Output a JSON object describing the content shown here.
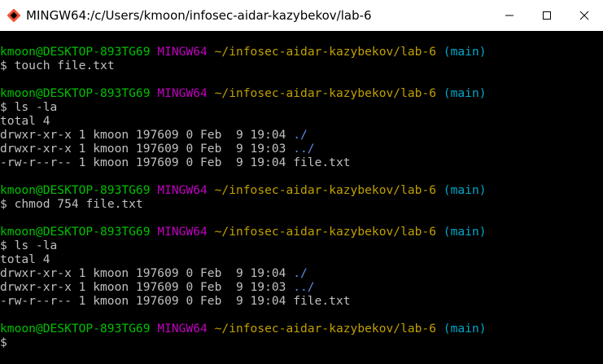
{
  "window": {
    "title": "MINGW64:/c/Users/kmoon/infosec-aidar-kazybekov/lab-6"
  },
  "prompt": {
    "user": "kmoon@DESKTOP-893TG69",
    "env": "MINGW64",
    "path": "~/infosec-aidar-kazybekov/lab-6",
    "branch": "(main)",
    "symbol": "$"
  },
  "blocks": [
    {
      "command": "touch file.txt",
      "output": []
    },
    {
      "command": "ls -la",
      "output": [
        {
          "text": "total 4"
        },
        {
          "text": "drwxr-xr-x 1 kmoon 197609 0 Feb  9 19:04 ",
          "name": "./",
          "is_dir": true
        },
        {
          "text": "drwxr-xr-x 1 kmoon 197609 0 Feb  9 19:03 ",
          "name": "../",
          "is_dir": true
        },
        {
          "text": "-rw-r--r-- 1 kmoon 197609 0 Feb  9 19:04 ",
          "name": "file.txt",
          "is_dir": false
        }
      ]
    },
    {
      "command": "chmod 754 file.txt",
      "output": []
    },
    {
      "command": "ls -la",
      "output": [
        {
          "text": "total 4"
        },
        {
          "text": "drwxr-xr-x 1 kmoon 197609 0 Feb  9 19:04 ",
          "name": "./",
          "is_dir": true
        },
        {
          "text": "drwxr-xr-x 1 kmoon 197609 0 Feb  9 19:03 ",
          "name": "../",
          "is_dir": true
        },
        {
          "text": "-rw-r--r-- 1 kmoon 197609 0 Feb  9 19:04 ",
          "name": "file.txt",
          "is_dir": false
        }
      ]
    },
    {
      "command": "",
      "output": []
    }
  ],
  "colors": {
    "user": "#00c000",
    "env": "#c000c0",
    "path": "#c0a000",
    "branch": "#00a8c8",
    "directory": "#5c8ce6",
    "text": "#c0c0c0",
    "background": "#000000"
  },
  "icons": {
    "app": "git-bash-icon",
    "minimize": "minimize-icon",
    "maximize": "maximize-icon",
    "close": "close-icon"
  }
}
